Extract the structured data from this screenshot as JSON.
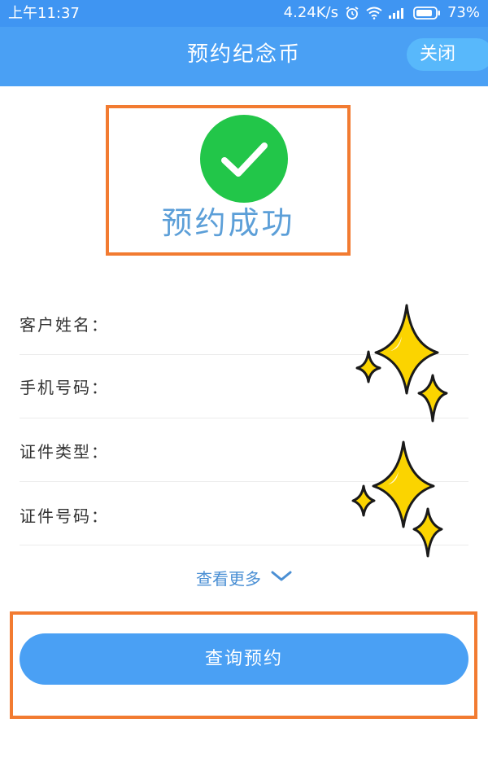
{
  "status_bar": {
    "time": "上午11:37",
    "network_speed": "4.24K/s",
    "battery": "73%",
    "icons": [
      "alarm-icon",
      "wifi-icon",
      "signal-icon",
      "battery-icon"
    ]
  },
  "header": {
    "title": "预约纪念币",
    "close_label": "关闭"
  },
  "success": {
    "icon": "checkmark-icon",
    "message": "预约成功"
  },
  "info_fields": [
    {
      "label": "客户姓名："
    },
    {
      "label": "手机号码："
    },
    {
      "label": "证件类型："
    },
    {
      "label": "证件号码："
    }
  ],
  "see_more": {
    "label": "查看更多",
    "icon": "chevron-down-icon"
  },
  "query_button": {
    "label": "查询预约"
  },
  "colors": {
    "primary": "#4aa0f4",
    "success": "#22c649",
    "highlight_border": "#f27b31",
    "sparkle": "#fbd400"
  }
}
